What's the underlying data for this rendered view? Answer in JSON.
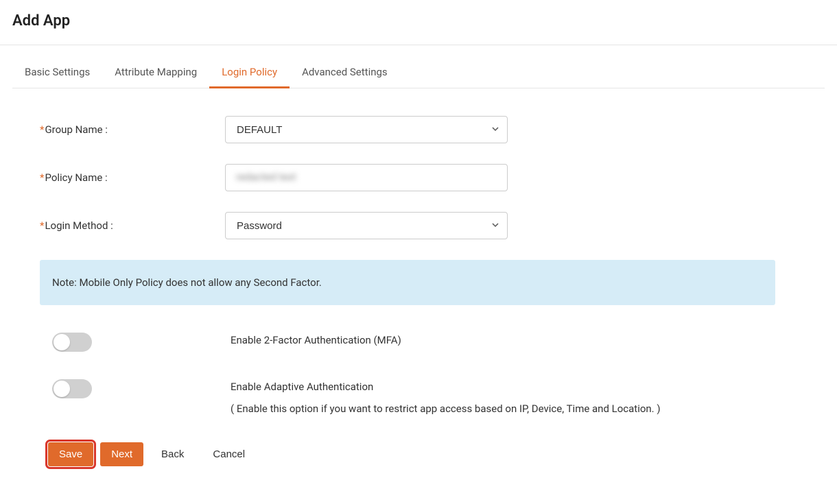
{
  "header": {
    "title": "Add App"
  },
  "tabs": [
    {
      "label": "Basic Settings",
      "active": false
    },
    {
      "label": "Attribute Mapping",
      "active": false
    },
    {
      "label": "Login Policy",
      "active": true
    },
    {
      "label": "Advanced Settings",
      "active": false
    }
  ],
  "form": {
    "group_name": {
      "label": "Group Name :",
      "value": "DEFAULT"
    },
    "policy_name": {
      "label": "Policy Name :",
      "value": "redacted text"
    },
    "login_method": {
      "label": "Login Method :",
      "value": "Password"
    }
  },
  "note": "Note: Mobile Only Policy does not allow any Second Factor.",
  "toggles": {
    "mfa": {
      "label": "Enable 2-Factor Authentication (MFA)",
      "enabled": false
    },
    "adaptive": {
      "label": "Enable Adaptive Authentication",
      "sublabel": "( Enable this option if you want to restrict app access based on IP, Device, Time and Location. )",
      "enabled": false
    }
  },
  "buttons": {
    "save": "Save",
    "next": "Next",
    "back": "Back",
    "cancel": "Cancel"
  }
}
